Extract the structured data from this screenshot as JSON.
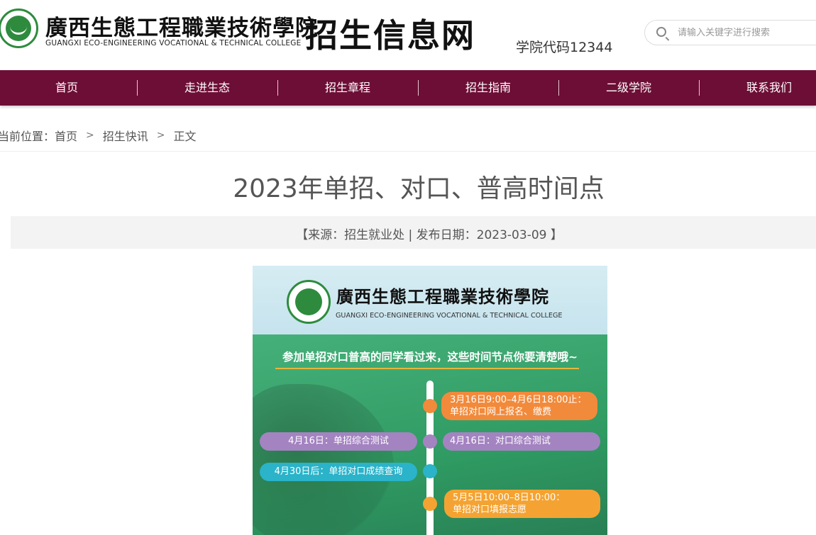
{
  "header": {
    "college_name_cn": "廣西生態工程職業技術學院",
    "college_name_en": "GUANGXI ECO-ENGINEERING VOCATIONAL & TECHNICAL COLLEGE",
    "site_title": "招生信息网",
    "school_code": "学院代码12344",
    "search_placeholder": "请输入关键字进行搜索",
    "logo_icon": "college-emblem-icon",
    "search_icon": "search-icon"
  },
  "nav": {
    "items": [
      {
        "label": "首页"
      },
      {
        "label": "走进生态"
      },
      {
        "label": "招生章程"
      },
      {
        "label": "招生指南"
      },
      {
        "label": "二级学院"
      },
      {
        "label": "联系我们"
      }
    ]
  },
  "breadcrumb": {
    "prefix": "当前位置：",
    "items": [
      "首页",
      "招生快讯",
      "正文"
    ],
    "separator": ">"
  },
  "article": {
    "title": "2023年单招、对口、普高时间点",
    "meta": "【来源：招生就业处 | 发布日期：2023-03-09 】"
  },
  "poster": {
    "college_name_cn": "廣西生態工程職業技術學院",
    "college_name_en": "GUANGXI ECO-ENGINEERING VOCATIONAL & TECHNICAL COLLEGE",
    "heading": "参加单招对口普高的同学看过来，这些时间节点你要清楚哦~",
    "events": [
      {
        "line1": "3月16日9:00–4月6日18:00止：",
        "line2": "单招对口网上报名、缴费",
        "color": "#f28a3b"
      },
      {
        "text": "4月16日：单招综合测试",
        "color": "#a483c1"
      },
      {
        "text": "4月16日：对口综合测试",
        "color": "#a483c1"
      },
      {
        "text": "4月30日后：单招对口成绩查询",
        "color": "#2ab3c9"
      },
      {
        "line1": "5月5日10:00–8日10:00：",
        "line2": "单招对口填报志愿",
        "color": "#f4a332"
      }
    ],
    "colors": {
      "accent": "#6d0e36",
      "poster_green": "#3aa46a",
      "underline": "#e7b63c"
    }
  }
}
